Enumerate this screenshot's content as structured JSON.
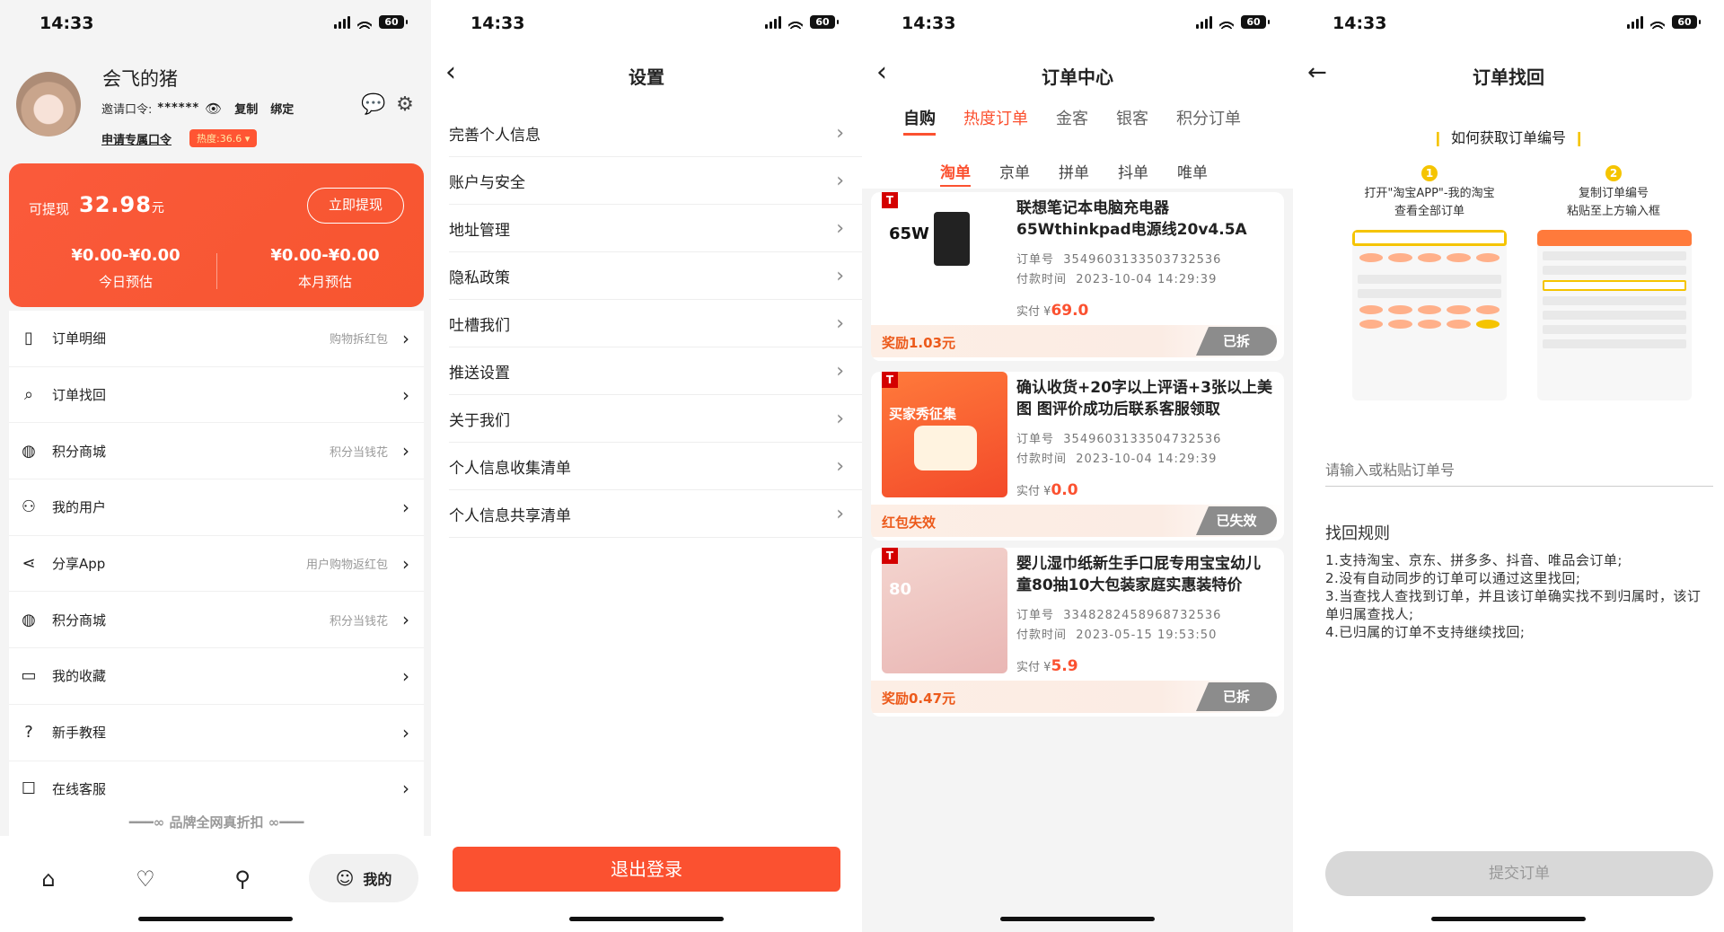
{
  "status": {
    "time": "14:33",
    "battery": "60"
  },
  "profile": {
    "username": "会飞的猪",
    "invite_label": "邀请口令:",
    "invite_code": "******",
    "copy_label": "复制",
    "bind_label": "绑定",
    "apply_link": "申请专属口令",
    "heat_badge": "热度:36.6"
  },
  "wallet": {
    "withdrawable_label": "可提现",
    "withdrawable_amount": "32.98",
    "unit": "元",
    "withdraw_button": "立即提现",
    "today_value": "¥0.00-¥0.00",
    "today_label": "今日预估",
    "month_value": "¥0.00-¥0.00",
    "month_label": "本月预估"
  },
  "menu": [
    {
      "label": "订单明细",
      "hint": "购物拆红包",
      "icon": "receipt-icon"
    },
    {
      "label": "订单找回",
      "hint": "",
      "icon": "search-order-icon"
    },
    {
      "label": "积分商城",
      "hint": "积分当钱花",
      "icon": "bag-icon"
    },
    {
      "label": "我的用户",
      "hint": "",
      "icon": "users-icon"
    },
    {
      "label": "分享App",
      "hint": "用户购物返红包",
      "icon": "share-icon"
    },
    {
      "label": "积分商城",
      "hint": "积分当钱花",
      "icon": "bag-icon"
    },
    {
      "label": "我的收藏",
      "hint": "",
      "icon": "folder-icon"
    },
    {
      "label": "新手教程",
      "hint": "",
      "icon": "question-icon"
    },
    {
      "label": "在线客服",
      "hint": "",
      "icon": "chat-icon"
    }
  ],
  "brand_tail": "━━━∞ 品牌全网真折扣 ∞━━━",
  "tabbar": {
    "mine_label": "我的"
  },
  "settings": {
    "title": "设置",
    "items": [
      "完善个人信息",
      "账户与安全",
      "地址管理",
      "隐私政策",
      "吐槽我们",
      "推送设置",
      "关于我们",
      "个人信息收集清单",
      "个人信息共享清单"
    ],
    "logout": "退出登录"
  },
  "orders": {
    "title": "订单中心",
    "tabs": [
      "自购",
      "热度订单",
      "金客",
      "银客",
      "积分订单"
    ],
    "platforms": [
      "淘单",
      "京单",
      "拼单",
      "抖单",
      "唯单"
    ],
    "order_no_label": "订单号",
    "pay_time_label": "付款时间",
    "paid_label": "实付",
    "currency": "¥",
    "items": [
      {
        "title": "联想笔记本电脑充电器65Wthinkpad电源线20v4.5A电…",
        "order_no": "3549603133503732536",
        "pay_time": "2023-10-04 14:29:39",
        "price": "69.0",
        "reward": "奖励1.03元",
        "status": "已拆",
        "img_text": "65W"
      },
      {
        "title": "确认收货+20字以上评语+3张以上美图 图评价成功后联系客服领取",
        "order_no": "3549603133504732536",
        "pay_time": "2023-10-04 14:29:39",
        "price": "0.0",
        "reward": "红包失效",
        "status": "已失效",
        "img_text": "买家秀征集"
      },
      {
        "title": "婴儿湿巾纸新生手口屁专用宝宝幼儿童80抽10大包装家庭实惠装特价",
        "order_no": "3348282458968732536",
        "pay_time": "2023-05-15 19:53:50",
        "price": "5.9",
        "reward": "奖励0.47元",
        "status": "已拆",
        "img_text": "80"
      }
    ]
  },
  "recover": {
    "title": "订单找回",
    "how_title": "如何获取订单编号",
    "step1": "打开\"淘宝APP\"-我的淘宝\n查看全部订单",
    "step2": "复制订单编号\n粘贴至上方输入框",
    "step1_num": "1",
    "step2_num": "2",
    "placeholder": "请输入或粘贴订单号",
    "rules_title": "找回规则",
    "rules": [
      " 1.支持淘宝、京东、拼多多、抖音、唯品会订单;",
      " 2.没有自动同步的订单可以通过这里找回;",
      " 3.当查找人查找到订单，并且该订单确实找不到归属时，该订单归属查找人;",
      " 4.已归属的订单不支持继续找回;"
    ],
    "submit": "提交订单"
  }
}
